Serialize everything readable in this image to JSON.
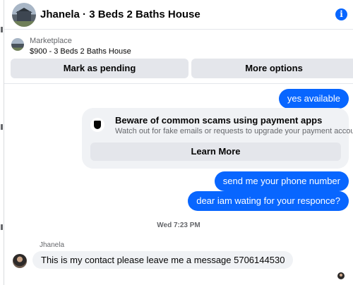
{
  "header": {
    "title": "Jhanela · 3 Beds 2 Baths House",
    "info_icon": "info-icon"
  },
  "marketplace": {
    "label": "Marketplace",
    "item": "$900 - 3 Beds 2 Baths House",
    "mark_pending": "Mark as pending",
    "more_options": "More options"
  },
  "messages": {
    "outgoing_1": "yes available",
    "warning_title": "Beware of common scams using payment apps",
    "warning_text": "Watch out for fake emails or requests to upgrade your payment account.",
    "learn_more": "Learn More",
    "outgoing_2": "send me your phone number",
    "outgoing_3": "dear iam wating for your responce?",
    "timestamp": "Wed 7:23 PM",
    "sender": "Jhanela",
    "incoming_1": "This is my contact please leave me a message 5706144530"
  },
  "colors": {
    "accent": "#0866ff",
    "bubble_in": "#f0f2f5",
    "button": "#e4e6eb"
  }
}
